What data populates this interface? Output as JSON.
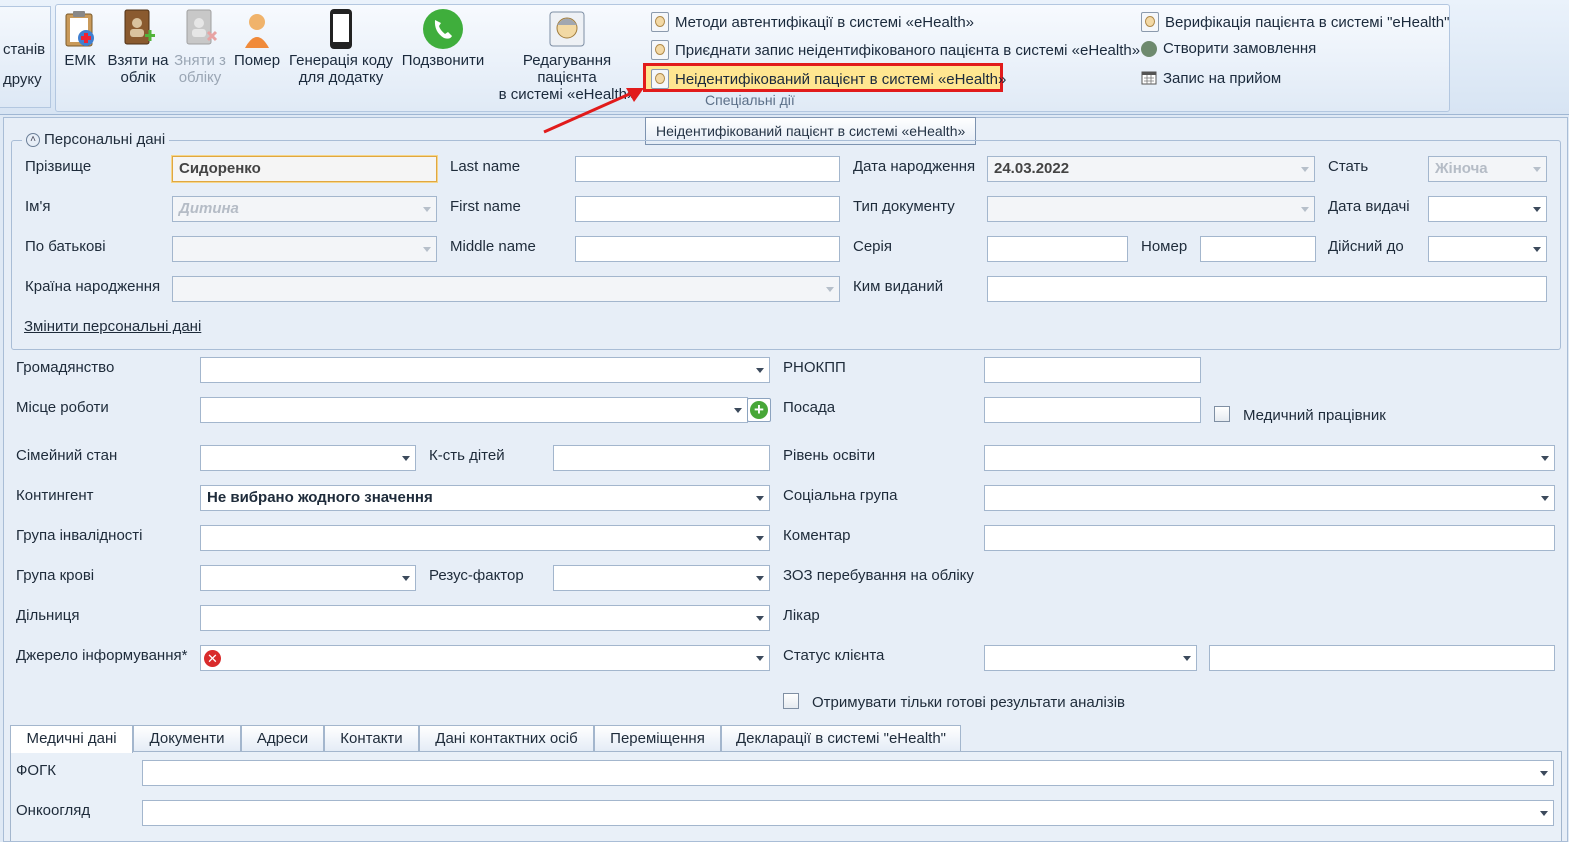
{
  "ribbon": {
    "left_group": {
      "line1": "станів",
      "line2": "друку"
    },
    "buttons": {
      "emk": {
        "label": "ЕМК"
      },
      "take": {
        "line1": "Взяти на",
        "line2": "облік"
      },
      "remove": {
        "line1": "Зняти з",
        "line2": "обліку"
      },
      "died": {
        "label": "Помер"
      },
      "gencode": {
        "line1": "Генерація коду",
        "line2": "для додатку"
      },
      "call": {
        "label": "Подзвонити"
      },
      "edit_patient": {
        "line1": "Редагування пацієнта",
        "line2": "в системі «eHealth»"
      }
    },
    "small_buttons": {
      "auth_methods": "Методи автентифікації в системі «eHealth»",
      "attach_record": "Приєднати запис неідентифікованого пацієнта в системі «eHealth»",
      "unidentified": "Неідентифікований пацієнт в системі «eHealth»",
      "verify": "Верифікація пацієнта в системі \"eHealth\"",
      "create_order": "Створити замовлення",
      "appointment": "Запис на прийом"
    },
    "group_label": "Спеціальні дії"
  },
  "tooltip": "Неідентифікований пацієнт в системі «eHealth»",
  "personal": {
    "legend": "Персональні дані",
    "labels": {
      "surname": "Прізвище",
      "name": "Ім'я",
      "patronymic": "По батькові",
      "country": "Країна народження",
      "last_name": "Last name",
      "first_name": "First name",
      "middle_name": "Middle name",
      "birth_date": "Дата народження",
      "doc_type": "Тип документу",
      "series": "Серія",
      "issued_by": "Ким виданий",
      "number": "Номер",
      "sex": "Стать",
      "issue_date": "Дата видачі",
      "valid_to": "Дійсний до"
    },
    "values": {
      "surname": "Сидоренко",
      "name": "Дитина",
      "birth_date": "24.03.2022",
      "sex": "Жіноча"
    },
    "change_link": "Змінити персональні дані"
  },
  "details": {
    "labels": {
      "citizenship": "Громадянство",
      "workplace": "Місце роботи",
      "marital": "Сімейний стан",
      "children": "К-сть дітей",
      "contingent": "Контингент",
      "disability": "Група інвалідності",
      "blood": "Група крові",
      "rh": "Резус-фактор",
      "district": "Дільниця",
      "info_source": "Джерело інформування*",
      "rnokpp": "РНОКПП",
      "position": "Посада",
      "medworker": "Медичний працівник",
      "education": "Рівень освіти",
      "social": "Соціальна група",
      "comment": "Коментар",
      "zoz": "ЗОЗ перебування на обліку",
      "doctor": "Лікар",
      "client_status": "Статус клієнта",
      "ready_results": "Отримувати тільки готові результати аналізів"
    },
    "values": {
      "contingent": "Не вибрано жодного значення"
    }
  },
  "tabs": [
    "Медичні дані",
    "Документи",
    "Адреси",
    "Контакти",
    "Дані контактних осіб",
    "Переміщення",
    "Декларації в системі \"eHealth\""
  ],
  "medical": {
    "labels": {
      "fogk": "ФОГК",
      "onco": "Онкоогляд"
    }
  },
  "colors": {
    "highlight_border": "#e11b1b",
    "highlight_fill": "#ffe690",
    "arrow": "#e11b1b"
  }
}
